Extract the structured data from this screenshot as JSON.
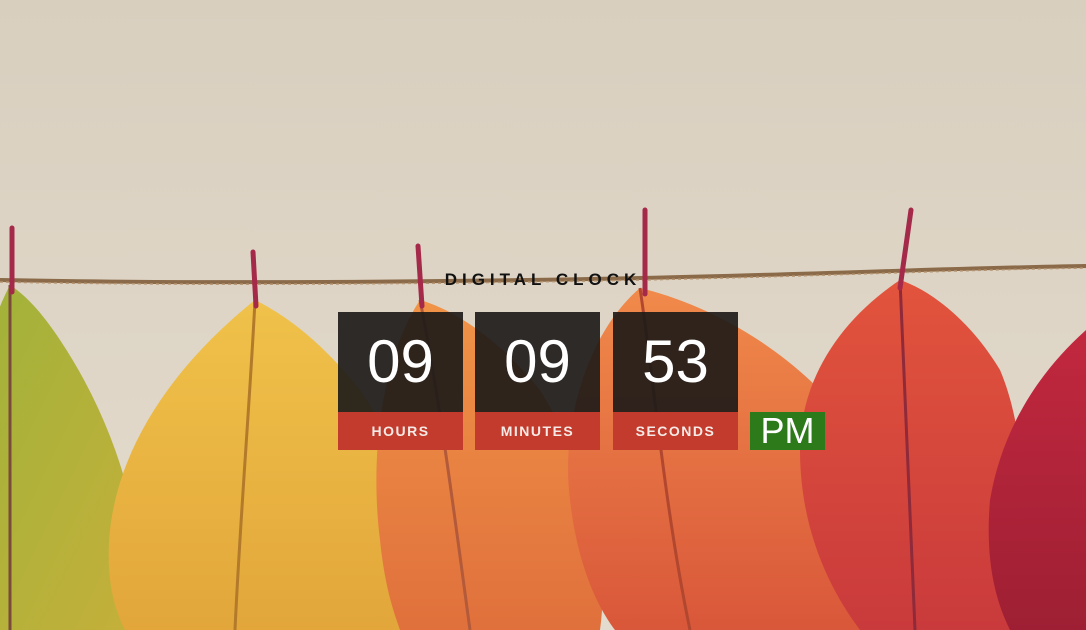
{
  "colors": {
    "background": "#dcd3c3",
    "digit_panel": "#1e1b19",
    "label_panel": "#c23b2d",
    "ampm_panel": "#2d7a1a",
    "text_light": "#ffffff",
    "title_text": "#111111"
  },
  "clock": {
    "title": "DIGITAL CLOCK",
    "hours": {
      "value": "09",
      "label": "HOURS"
    },
    "minutes": {
      "value": "09",
      "label": "MINUTES"
    },
    "seconds": {
      "value": "53",
      "label": "SECONDS"
    },
    "period": "PM"
  }
}
